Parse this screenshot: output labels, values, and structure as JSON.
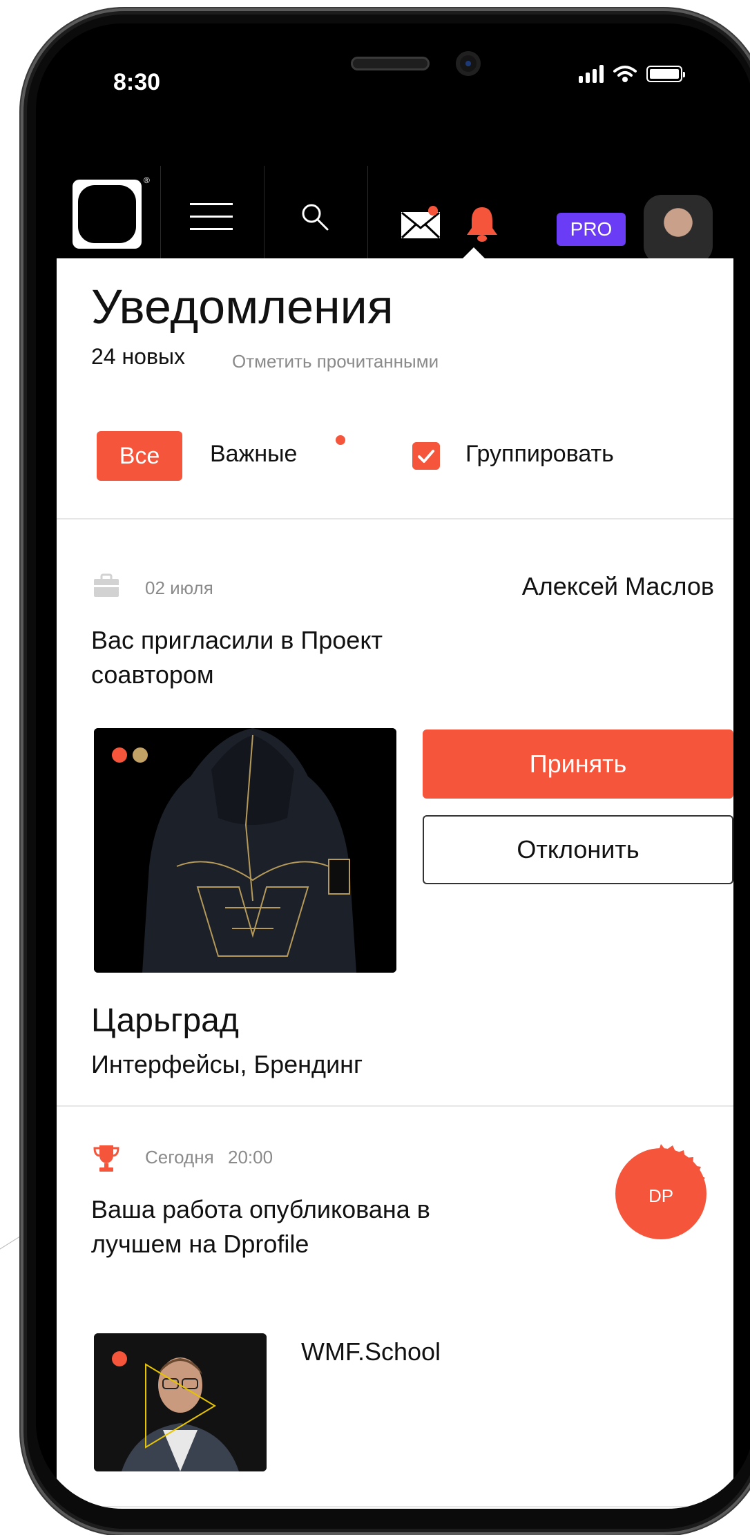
{
  "status_bar": {
    "time": "8:30"
  },
  "header": {
    "pro_badge": "PRO",
    "logo_mark": "®"
  },
  "notifications": {
    "title": "Уведомления",
    "new_count": "24 новых",
    "mark_read": "Отметить прочитанными",
    "tabs": {
      "all": "Все",
      "important": "Важные"
    },
    "group_label": "Группировать"
  },
  "cards": [
    {
      "date": "02 июля",
      "author": "Алексей Маслов",
      "text": "Вас пригласили в Проект соавтором",
      "accept": "Принять",
      "decline": "Отклонить",
      "project_title": "Царьград",
      "project_tags": "Интерфейсы, Брендинг"
    },
    {
      "date": "Сегодня",
      "time": "20:00",
      "text": "Ваша работа опубликована в лучшем на Dprofile",
      "badge": "DP",
      "company": "WMF.School"
    }
  ],
  "colors": {
    "accent": "#f5553a",
    "pro": "#6a3cf5",
    "muted_text": "#8a8a8a"
  },
  "icons": [
    "briefcase-icon",
    "trophy-icon",
    "mail-icon",
    "bell-icon",
    "search-icon",
    "menu-icon",
    "checkbox-checked-icon",
    "play-icon"
  ]
}
